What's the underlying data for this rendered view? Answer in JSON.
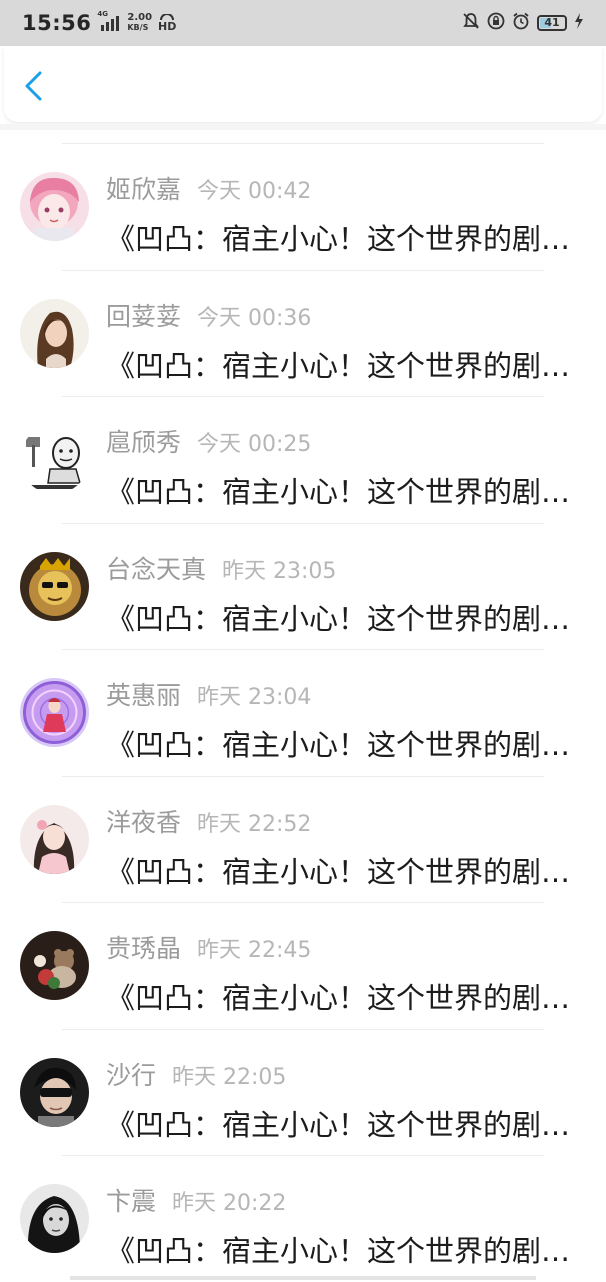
{
  "status_bar": {
    "time": "15:56",
    "network": "4G",
    "speed_value": "2.00",
    "speed_unit": "KB/S",
    "hd_label": "HD",
    "battery": "41",
    "battery_level": 0.41,
    "icons": [
      "signal-icon",
      "mute-bell-icon",
      "lock-rotation-icon",
      "alarm-icon",
      "battery-icon",
      "charging-icon"
    ]
  },
  "header": {
    "back_icon": "chevron-left-icon",
    "accent_color": "#1a9fe8"
  },
  "conversations": [
    {
      "name": "姬欣嘉",
      "time": "今天 00:42",
      "message": "《凹凸：宿主小心！这个世界的剧情有毒》",
      "avatar_theme": "pink-anime"
    },
    {
      "name": "回荽荽",
      "time": "今天 00:36",
      "message": "《凹凸：宿主小心！这个世界的剧情有毒》",
      "avatar_theme": "woman-portrait"
    },
    {
      "name": "扈颀秀",
      "time": "今天 00:25",
      "message": "《凹凸：宿主小心！这个世界的剧情有毒》",
      "avatar_theme": "meme-sticker"
    },
    {
      "name": "台念天真",
      "time": "昨天 23:05",
      "message": "《凹凸：宿主小心！这个世界的剧情有毒》",
      "avatar_theme": "lion-king"
    },
    {
      "name": "英惠丽",
      "time": "昨天 23:04",
      "message": "《凹凸：宿主小心！这个世界的剧情有毒》",
      "avatar_theme": "magic-circle"
    },
    {
      "name": "洋夜香",
      "time": "昨天 22:52",
      "message": "《凹凸：宿主小心！这个世界的剧情有毒》",
      "avatar_theme": "girl-pink"
    },
    {
      "name": "贵琇晶",
      "time": "昨天 22:45",
      "message": "《凹凸：宿主小心！这个世界的剧情有毒》",
      "avatar_theme": "teddy-bear"
    },
    {
      "name": "沙行",
      "time": "昨天 22:05",
      "message": "《凹凸：宿主小心！这个世界的剧情有毒》",
      "avatar_theme": "sunglasses-boy"
    },
    {
      "name": "卞震",
      "time": "昨天 20:22",
      "message": "《凹凸：宿主小心！这个世界的剧情有毒》",
      "avatar_theme": "bw-girl"
    }
  ]
}
